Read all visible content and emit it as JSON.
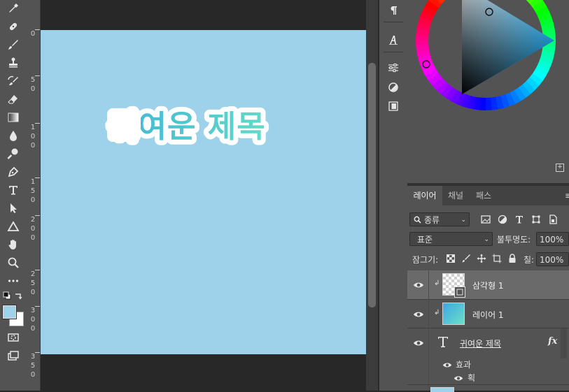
{
  "ruler": {
    "marks": [
      {
        "digits": [
          "0"
        ]
      },
      {
        "digits": [
          "5",
          "0"
        ]
      },
      {
        "digits": [
          "1",
          "0",
          "0"
        ]
      },
      {
        "digits": [
          "1",
          "5",
          "0"
        ]
      },
      {
        "digits": [
          "2",
          "0",
          "0"
        ]
      },
      {
        "digits": [
          "2",
          "5",
          "0"
        ]
      },
      {
        "digits": [
          "3",
          "0",
          "0"
        ]
      },
      {
        "digits": [
          "3",
          "5",
          "0"
        ]
      }
    ]
  },
  "tools": [
    "eyedropper-icon",
    "healing-brush-icon",
    "brush-icon",
    "stamp-icon",
    "history-brush-icon",
    "eraser-icon",
    "gradient-icon",
    "blur-icon",
    "dodge-icon",
    "pen-icon",
    "type-icon",
    "path-select-icon",
    "shape-icon",
    "hand-icon",
    "zoom-icon",
    "more-tools-icon"
  ],
  "canvas": {
    "title_text": "귀여운 제목",
    "bg_color": "#9ed2ea",
    "title_colors": [
      "#3db6d8",
      "#63d9c7"
    ]
  },
  "colors": {
    "foreground": "#9ed2ea",
    "background": "#ffffff"
  },
  "layers_panel": {
    "tabs": [
      {
        "label": "레이어",
        "active": true
      },
      {
        "label": "채널",
        "active": false
      },
      {
        "label": "패스",
        "active": false
      }
    ],
    "filter": {
      "label": "종류"
    },
    "blend_mode": "표준",
    "opacity_label": "불투명도:",
    "opacity_value": "100%",
    "lock_label": "잠그기:",
    "fill_label": "칠:",
    "fill_value": "100%",
    "layers": [
      {
        "name": "삼각형 1",
        "kind": "shape",
        "selected": true
      },
      {
        "name": "레이어 1",
        "kind": "gradient",
        "selected": false
      },
      {
        "name": "귀여운 제목",
        "kind": "text",
        "selected": false,
        "fx": "fx"
      }
    ],
    "effects_label": "효과",
    "stroke_label": "획"
  }
}
